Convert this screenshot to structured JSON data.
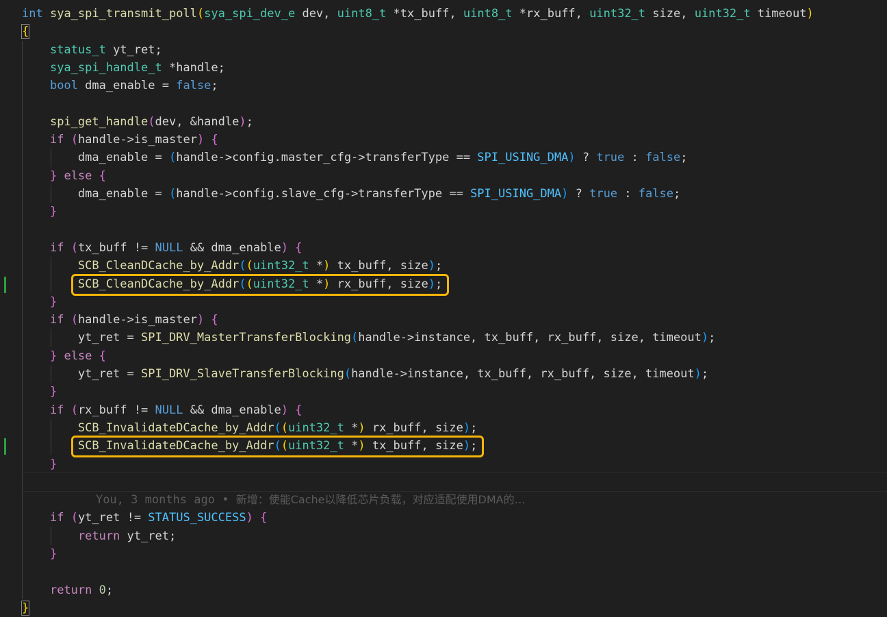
{
  "colors": {
    "background": "#1f1f1f",
    "keyword": "#569cd6",
    "control": "#c586c0",
    "type": "#4ec9b0",
    "function": "#dcdcaa",
    "variable": "#9cdcfe",
    "constant": "#4fc1ff",
    "number": "#b5cea8",
    "plain": "#d4d4d4",
    "bracket1": "#ffd700",
    "bracket2": "#da70d6",
    "bracket3": "#179fff",
    "highlight_box": "#f5b50a",
    "git_added": "#2ea043",
    "blame_text": "#5a5a5a"
  },
  "code": {
    "lines": [
      {
        "tokens": [
          [
            "int",
            "keyword"
          ],
          [
            " ",
            "plain"
          ],
          [
            "sya_spi_transmit_poll",
            "function"
          ],
          [
            "(",
            "bracket1"
          ],
          [
            "sya_spi_dev_e",
            "type"
          ],
          [
            " dev, ",
            "plain"
          ],
          [
            "uint8_t",
            "type"
          ],
          [
            " *tx_buff, ",
            "plain"
          ],
          [
            "uint8_t",
            "type"
          ],
          [
            " *rx_buff, ",
            "plain"
          ],
          [
            "uint32_t",
            "type"
          ],
          [
            " size, ",
            "plain"
          ],
          [
            "uint32_t",
            "type"
          ],
          [
            " timeout",
            "plain"
          ],
          [
            ")",
            "bracket1"
          ]
        ]
      },
      {
        "tokens": [
          [
            "{",
            "bracket1"
          ]
        ]
      },
      {
        "tokens": [
          [
            "    ",
            "plain"
          ],
          [
            "status_t",
            "type"
          ],
          [
            " yt_ret;",
            "plain"
          ]
        ]
      },
      {
        "tokens": [
          [
            "    ",
            "plain"
          ],
          [
            "sya_spi_handle_t",
            "type"
          ],
          [
            " *handle;",
            "plain"
          ]
        ]
      },
      {
        "tokens": [
          [
            "    ",
            "plain"
          ],
          [
            "bool",
            "keyword"
          ],
          [
            " dma_enable = ",
            "plain"
          ],
          [
            "false",
            "keyword"
          ],
          [
            ";",
            "plain"
          ]
        ]
      },
      {
        "tokens": []
      },
      {
        "tokens": [
          [
            "    ",
            "plain"
          ],
          [
            "spi_get_handle",
            "function"
          ],
          [
            "(",
            "bracket2"
          ],
          [
            "dev, &handle",
            "plain"
          ],
          [
            ")",
            "bracket2"
          ],
          [
            ";",
            "plain"
          ]
        ]
      },
      {
        "tokens": [
          [
            "    ",
            "plain"
          ],
          [
            "if",
            "control"
          ],
          [
            " ",
            "plain"
          ],
          [
            "(",
            "bracket2"
          ],
          [
            "handle->is_master",
            "plain"
          ],
          [
            ")",
            "bracket2"
          ],
          [
            " ",
            "plain"
          ],
          [
            "{",
            "bracket2"
          ]
        ]
      },
      {
        "tokens": [
          [
            "        dma_enable = ",
            "plain"
          ],
          [
            "(",
            "bracket3"
          ],
          [
            "handle->config.master_cfg->transferType == ",
            "plain"
          ],
          [
            "SPI_USING_DMA",
            "constant"
          ],
          [
            ")",
            "bracket3"
          ],
          [
            " ? ",
            "plain"
          ],
          [
            "true",
            "keyword"
          ],
          [
            " : ",
            "plain"
          ],
          [
            "false",
            "keyword"
          ],
          [
            ";",
            "plain"
          ]
        ]
      },
      {
        "tokens": [
          [
            "    ",
            "plain"
          ],
          [
            "}",
            "bracket2"
          ],
          [
            " ",
            "plain"
          ],
          [
            "else",
            "control"
          ],
          [
            " ",
            "plain"
          ],
          [
            "{",
            "bracket2"
          ]
        ]
      },
      {
        "tokens": [
          [
            "        dma_enable = ",
            "plain"
          ],
          [
            "(",
            "bracket3"
          ],
          [
            "handle->config.slave_cfg->transferType == ",
            "plain"
          ],
          [
            "SPI_USING_DMA",
            "constant"
          ],
          [
            ")",
            "bracket3"
          ],
          [
            " ? ",
            "plain"
          ],
          [
            "true",
            "keyword"
          ],
          [
            " : ",
            "plain"
          ],
          [
            "false",
            "keyword"
          ],
          [
            ";",
            "plain"
          ]
        ]
      },
      {
        "tokens": [
          [
            "    ",
            "plain"
          ],
          [
            "}",
            "bracket2"
          ]
        ]
      },
      {
        "tokens": []
      },
      {
        "tokens": [
          [
            "    ",
            "plain"
          ],
          [
            "if",
            "control"
          ],
          [
            " ",
            "plain"
          ],
          [
            "(",
            "bracket2"
          ],
          [
            "tx_buff != ",
            "plain"
          ],
          [
            "NULL",
            "keyword"
          ],
          [
            " && dma_enable",
            "plain"
          ],
          [
            ")",
            "bracket2"
          ],
          [
            " ",
            "plain"
          ],
          [
            "{",
            "bracket2"
          ]
        ]
      },
      {
        "tokens": [
          [
            "        ",
            "plain"
          ],
          [
            "SCB_CleanDCache_by_Addr",
            "function"
          ],
          [
            "(",
            "bracket3"
          ],
          [
            "(",
            "bracket1"
          ],
          [
            "uint32_t",
            "type"
          ],
          [
            " *",
            "plain"
          ],
          [
            ")",
            "bracket1"
          ],
          [
            " tx_buff, size",
            "plain"
          ],
          [
            ")",
            "bracket3"
          ],
          [
            ";",
            "plain"
          ]
        ]
      },
      {
        "tokens": [
          [
            "        ",
            "plain"
          ],
          [
            "SCB_CleanDCache_by_Addr",
            "function"
          ],
          [
            "(",
            "bracket3"
          ],
          [
            "(",
            "bracket1"
          ],
          [
            "uint32_t",
            "type"
          ],
          [
            " *",
            "plain"
          ],
          [
            ")",
            "bracket1"
          ],
          [
            " rx_buff, size",
            "plain"
          ],
          [
            ")",
            "bracket3"
          ],
          [
            ";",
            "plain"
          ]
        ]
      },
      {
        "tokens": [
          [
            "    ",
            "plain"
          ],
          [
            "}",
            "bracket2"
          ]
        ]
      },
      {
        "tokens": [
          [
            "    ",
            "plain"
          ],
          [
            "if",
            "control"
          ],
          [
            " ",
            "plain"
          ],
          [
            "(",
            "bracket2"
          ],
          [
            "handle->is_master",
            "plain"
          ],
          [
            ")",
            "bracket2"
          ],
          [
            " ",
            "plain"
          ],
          [
            "{",
            "bracket2"
          ]
        ]
      },
      {
        "tokens": [
          [
            "        yt_ret = ",
            "plain"
          ],
          [
            "SPI_DRV_MasterTransferBlocking",
            "function"
          ],
          [
            "(",
            "bracket3"
          ],
          [
            "handle->instance, tx_buff, rx_buff, size, timeout",
            "plain"
          ],
          [
            ")",
            "bracket3"
          ],
          [
            ";",
            "plain"
          ]
        ]
      },
      {
        "tokens": [
          [
            "    ",
            "plain"
          ],
          [
            "}",
            "bracket2"
          ],
          [
            " ",
            "plain"
          ],
          [
            "else",
            "control"
          ],
          [
            " ",
            "plain"
          ],
          [
            "{",
            "bracket2"
          ]
        ]
      },
      {
        "tokens": [
          [
            "        yt_ret = ",
            "plain"
          ],
          [
            "SPI_DRV_SlaveTransferBlocking",
            "function"
          ],
          [
            "(",
            "bracket3"
          ],
          [
            "handle->instance, tx_buff, rx_buff, size, timeout",
            "plain"
          ],
          [
            ")",
            "bracket3"
          ],
          [
            ";",
            "plain"
          ]
        ]
      },
      {
        "tokens": [
          [
            "    ",
            "plain"
          ],
          [
            "}",
            "bracket2"
          ]
        ]
      },
      {
        "tokens": [
          [
            "    ",
            "plain"
          ],
          [
            "if",
            "control"
          ],
          [
            " ",
            "plain"
          ],
          [
            "(",
            "bracket2"
          ],
          [
            "rx_buff != ",
            "plain"
          ],
          [
            "NULL",
            "keyword"
          ],
          [
            " && dma_enable",
            "plain"
          ],
          [
            ")",
            "bracket2"
          ],
          [
            " ",
            "plain"
          ],
          [
            "{",
            "bracket2"
          ]
        ]
      },
      {
        "tokens": [
          [
            "        ",
            "plain"
          ],
          [
            "SCB_InvalidateDCache_by_Addr",
            "function"
          ],
          [
            "(",
            "bracket3"
          ],
          [
            "(",
            "bracket1"
          ],
          [
            "uint32_t",
            "type"
          ],
          [
            " *",
            "plain"
          ],
          [
            ")",
            "bracket1"
          ],
          [
            " rx_buff, size",
            "plain"
          ],
          [
            ")",
            "bracket3"
          ],
          [
            ";",
            "plain"
          ]
        ]
      },
      {
        "tokens": [
          [
            "        ",
            "plain"
          ],
          [
            "SCB_InvalidateDCache_by_Addr",
            "function"
          ],
          [
            "(",
            "bracket3"
          ],
          [
            "(",
            "bracket1"
          ],
          [
            "uint32_t",
            "type"
          ],
          [
            " *",
            "plain"
          ],
          [
            ")",
            "bracket1"
          ],
          [
            " tx_buff, size",
            "plain"
          ],
          [
            ")",
            "bracket3"
          ],
          [
            ";",
            "plain"
          ]
        ]
      },
      {
        "tokens": [
          [
            "    ",
            "plain"
          ],
          [
            "}",
            "bracket2"
          ]
        ]
      },
      {
        "tokens": []
      },
      {
        "tokens": [
          [
            "    ",
            "plain"
          ],
          [
            "if",
            "control"
          ],
          [
            " ",
            "plain"
          ],
          [
            "(",
            "bracket2"
          ],
          [
            "yt_ret != ",
            "plain"
          ],
          [
            "STATUS_SUCCESS",
            "constant"
          ],
          [
            ")",
            "bracket2"
          ],
          [
            " ",
            "plain"
          ],
          [
            "{",
            "bracket2"
          ]
        ]
      },
      {
        "tokens": [
          [
            "        ",
            "plain"
          ],
          [
            "return",
            "control"
          ],
          [
            " yt_ret;",
            "plain"
          ]
        ]
      },
      {
        "tokens": [
          [
            "    ",
            "plain"
          ],
          [
            "}",
            "bracket2"
          ]
        ]
      },
      {
        "tokens": []
      },
      {
        "tokens": [
          [
            "    ",
            "plain"
          ],
          [
            "return",
            "control"
          ],
          [
            " ",
            "plain"
          ],
          [
            "0",
            "number"
          ],
          [
            ";",
            "plain"
          ]
        ]
      },
      {
        "tokens": [
          [
            "}",
            "bracket1"
          ]
        ]
      }
    ],
    "highlighted_lines": [
      15,
      24
    ],
    "git_added_lines": [
      15,
      24
    ],
    "blame": {
      "author": "You",
      "age": "3 months ago",
      "separator": "•",
      "message": "新增：使能Cache以降低芯片负载，对应适配使用DMA的…"
    }
  }
}
